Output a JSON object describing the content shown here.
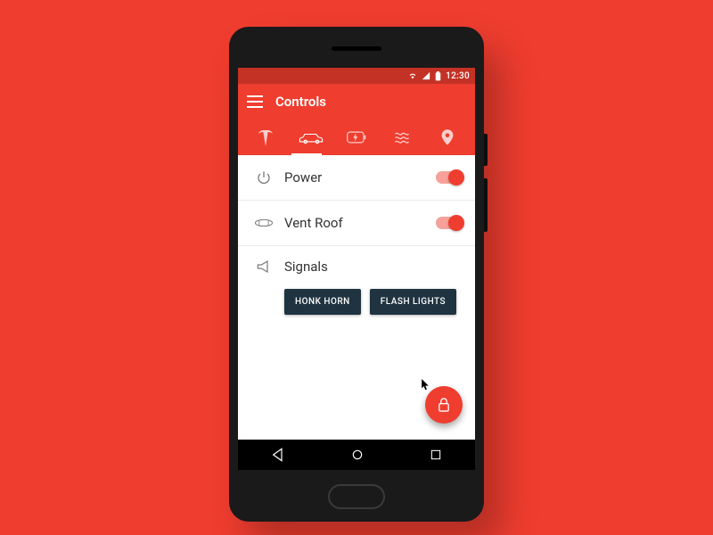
{
  "colors": {
    "accent": "#ef3d2f",
    "statusbar": "#c33225",
    "button": "#1f3340"
  },
  "statusbar": {
    "time": "12:30"
  },
  "appbar": {
    "title": "Controls"
  },
  "tabs": {
    "items": [
      {
        "name": "tesla-icon"
      },
      {
        "name": "car-icon"
      },
      {
        "name": "battery-icon"
      },
      {
        "name": "climate-icon"
      },
      {
        "name": "location-pin-icon"
      }
    ],
    "active_index": 1
  },
  "rows": {
    "power": {
      "label": "Power",
      "on": true
    },
    "ventroof": {
      "label": "Vent Roof",
      "on": true
    }
  },
  "signals": {
    "label": "Signals",
    "buttons": {
      "honk": "HONK HORN",
      "flash": "FLASH LIGHTS"
    }
  },
  "fab": {
    "icon": "lock-icon"
  }
}
